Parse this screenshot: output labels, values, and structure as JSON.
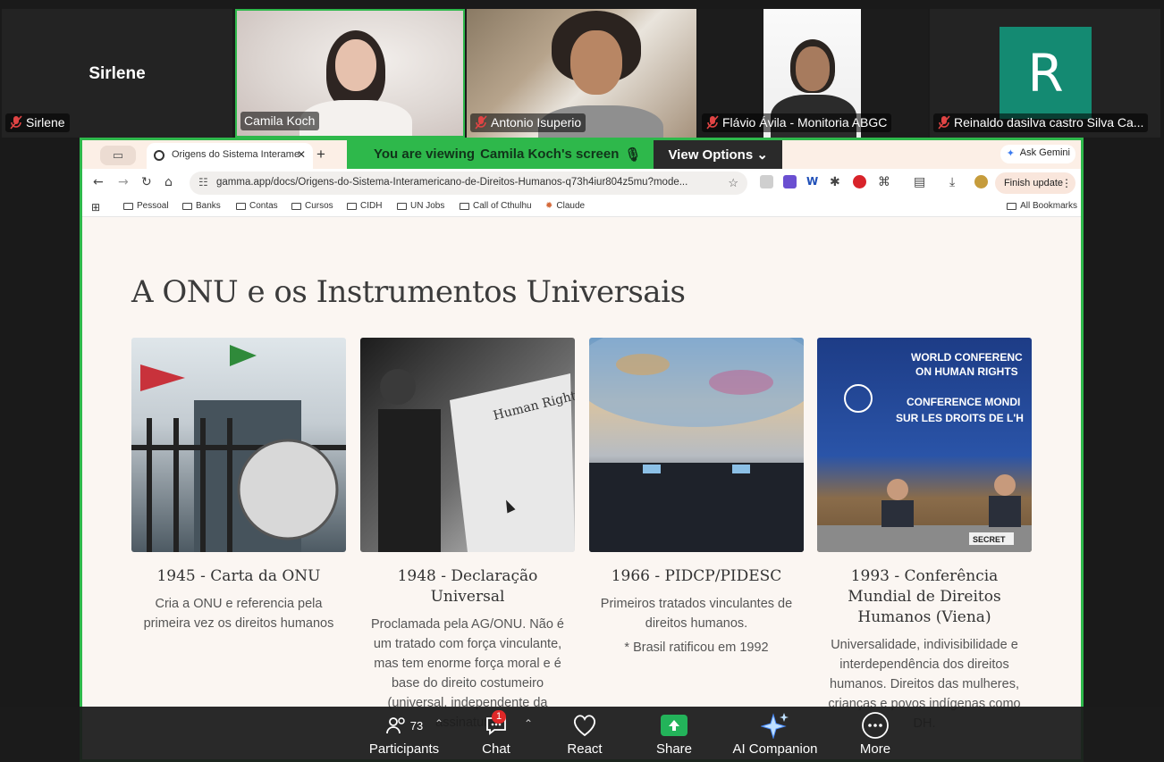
{
  "participants": [
    {
      "name": "Sirlene",
      "big_name": "Sirlene"
    },
    {
      "name": "Camila Koch"
    },
    {
      "name": "Antonio Isuperio"
    },
    {
      "name": "Flávio Ávila - Monitoria ABGC"
    },
    {
      "name": "Reinaldo dasilva castro Silva Ca...",
      "initial": "R"
    }
  ],
  "share_banner": {
    "viewing_prefix": "You are viewing",
    "presenter": "Camila Koch's screen",
    "view_options": "View Options"
  },
  "browser": {
    "tab_title": "Origens do Sistema Interame",
    "ask_gemini": "Ask Gemini",
    "url": "gamma.app/docs/Origens-do-Sistema-Interamericano-de-Direitos-Humanos-q73h4iur804z5mu?mode...",
    "finish_update": "Finish update",
    "bookmarks": [
      "Pessoal",
      "Banks",
      "Contas",
      "Cursos",
      "CIDH",
      "UN Jobs",
      "Call of Cthulhu",
      "Claude"
    ],
    "all_bookmarks": "All Bookmarks"
  },
  "page": {
    "title": "A ONU e os Instrumentos Universais",
    "cards": [
      {
        "title": "1945 - Carta da ONU",
        "text": "Cria a ONU e referencia pela primeira vez os direitos humanos",
        "note": ""
      },
      {
        "title": "1948 - Declaração Universal",
        "text": "Proclamada pela AG/ONU. Não é um tratado com força vinculante, mas tem enorme força moral e é base do direito costumeiro (universal, independente da assinatura)",
        "note": ""
      },
      {
        "title": "1966 - PIDCP/PIDESC",
        "text": "Primeiros tratados vinculantes de direitos humanos.",
        "note": "* Brasil ratificou em 1992"
      },
      {
        "title": "1993 - Conferência Mundial de Direitos Humanos (Viena)",
        "text": "Universalidade, indivisibilidade e interdependência dos direitos humanos. Direitos das mulheres, crianças e povos indígenas como DH.",
        "note": ""
      }
    ],
    "image_text": {
      "img2": "Human Rights",
      "img4_line1": "WORLD CONFERENC",
      "img4_line2": "ON HUMAN RIGHTS",
      "img4_line3": "CONFERENCE MONDI",
      "img4_line4": "SUR LES DROITS DE L'H",
      "img4_sign": "SECRET"
    }
  },
  "toolbar": {
    "participants_label": "Participants",
    "participants_count": "73",
    "chat_label": "Chat",
    "chat_badge": "1",
    "react_label": "React",
    "share_label": "Share",
    "ai_label": "AI Companion",
    "more_label": "More"
  },
  "colors": {
    "active_speaker": "#2eb84b",
    "avatar_bg": "#148a72",
    "share_green": "#23b35a",
    "badge_red": "#e02828"
  }
}
